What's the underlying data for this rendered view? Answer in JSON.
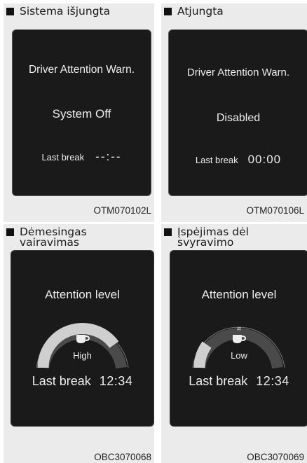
{
  "panels": [
    {
      "heading": "Sistema išjungta",
      "title": "Driver Attention Warn.",
      "state": "System Off",
      "break_label": "Last break",
      "break_time": "--:--",
      "code": "OTM070102L"
    },
    {
      "heading": "Atjungta",
      "title": "Driver Attention Warn.",
      "state": "Disabled",
      "break_label": "Last break",
      "break_time": "00:00",
      "code": "OTM070106L"
    },
    {
      "heading": "Dėmesingas vairavimas",
      "label": "Attention level",
      "level": "High",
      "level_fraction": 0.8,
      "break_label": "Last break",
      "break_time": "12:34",
      "icon": "cup-icon",
      "code": "OBC3070068"
    },
    {
      "heading": "Įspėjimas dėl svyravimo",
      "label": "Attention level",
      "level": "Low",
      "level_fraction": 0.2,
      "break_label": "Last break",
      "break_time": "12:34",
      "icon": "steaming-cup-icon",
      "code": "OBC3070069"
    }
  ],
  "colors": {
    "panel_bg": "#ebebeb",
    "screen_bg": "#1a1a1a",
    "screen_text": "#eeeeee"
  }
}
